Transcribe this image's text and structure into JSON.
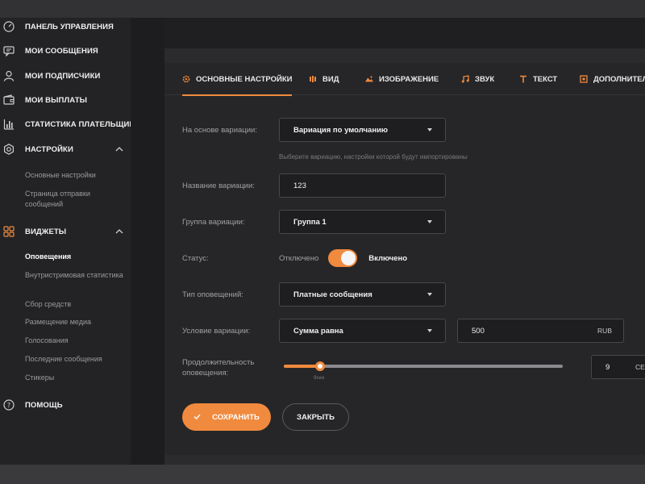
{
  "sidebar": {
    "items": [
      {
        "label": "ПАНЕЛЬ УПРАВЛЕНИЯ",
        "icon": "dashboard-gauge-icon"
      },
      {
        "label": "МОИ СООБЩЕНИЯ",
        "icon": "message-icon"
      },
      {
        "label": "МОИ ПОДПИСЧИКИ",
        "icon": "user-icon"
      },
      {
        "label": "МОИ ВЫПЛАТЫ",
        "icon": "wallet-icon"
      },
      {
        "label": "СТАТИСТИКА ПЛАТЕЛЬЩИКОВ",
        "icon": "bar-chart-icon"
      },
      {
        "label": "НАСТРОЙКИ",
        "icon": "gear-icon"
      },
      {
        "label": "ВИДЖЕТЫ",
        "icon": "grid-icon"
      },
      {
        "label": "ПОМОЩЬ",
        "icon": "help-icon"
      }
    ],
    "settings_sub": [
      "Основные настройки",
      "Страница отправки сообщений"
    ],
    "widgets_sub": [
      "Оповещения",
      "Внутристримовая статистика",
      "Сбор средств",
      "Размещение медиа",
      "Голосования",
      "Последние сообщения",
      "Стикеры"
    ]
  },
  "tabs": [
    {
      "label": "ОСНОВНЫЕ НАСТРОЙКИ",
      "icon": "gear-icon"
    },
    {
      "label": "ВИД",
      "icon": "view-icon"
    },
    {
      "label": "ИЗОБРАЖЕНИЕ",
      "icon": "image-icon"
    },
    {
      "label": "ЗВУК",
      "icon": "music-note-icon"
    },
    {
      "label": "ТЕКСТ",
      "icon": "text-icon"
    },
    {
      "label": "ДОПОЛНИТЕЛ",
      "icon": "extra-icon"
    }
  ],
  "form": {
    "variation_base_label": "На основе вариации:",
    "variation_base_value": "Вариация по умолчанию",
    "variation_base_hint": "Выберите вариацию, настройки которой будут импортированы",
    "variation_name_label": "Название вариации:",
    "variation_name_value": "123",
    "variation_group_label": "Группа вариации:",
    "variation_group_value": "Группа 1",
    "status_label": "Статус:",
    "status_off": "Отключено",
    "status_on": "Включено",
    "alert_type_label": "Тип оповещений:",
    "alert_type_value": "Платные сообщения",
    "condition_label": "Условие вариации:",
    "condition_value": "Сумма равна",
    "amount_value": "500",
    "amount_unit": "RUB",
    "duration_label": "Продолжительность оповещения:",
    "duration_value": "9",
    "duration_unit": "СЕК",
    "duration_slider_fraction": 0.13,
    "duration_slider_caption": "9сек"
  },
  "buttons": {
    "save": "СОХРАНИТЬ",
    "close": "ЗАКРЫТЬ"
  },
  "colors": {
    "accent": "#f08a3e",
    "background": "#2b2b2d",
    "sidebar": "#232325",
    "panel": "#262628"
  }
}
